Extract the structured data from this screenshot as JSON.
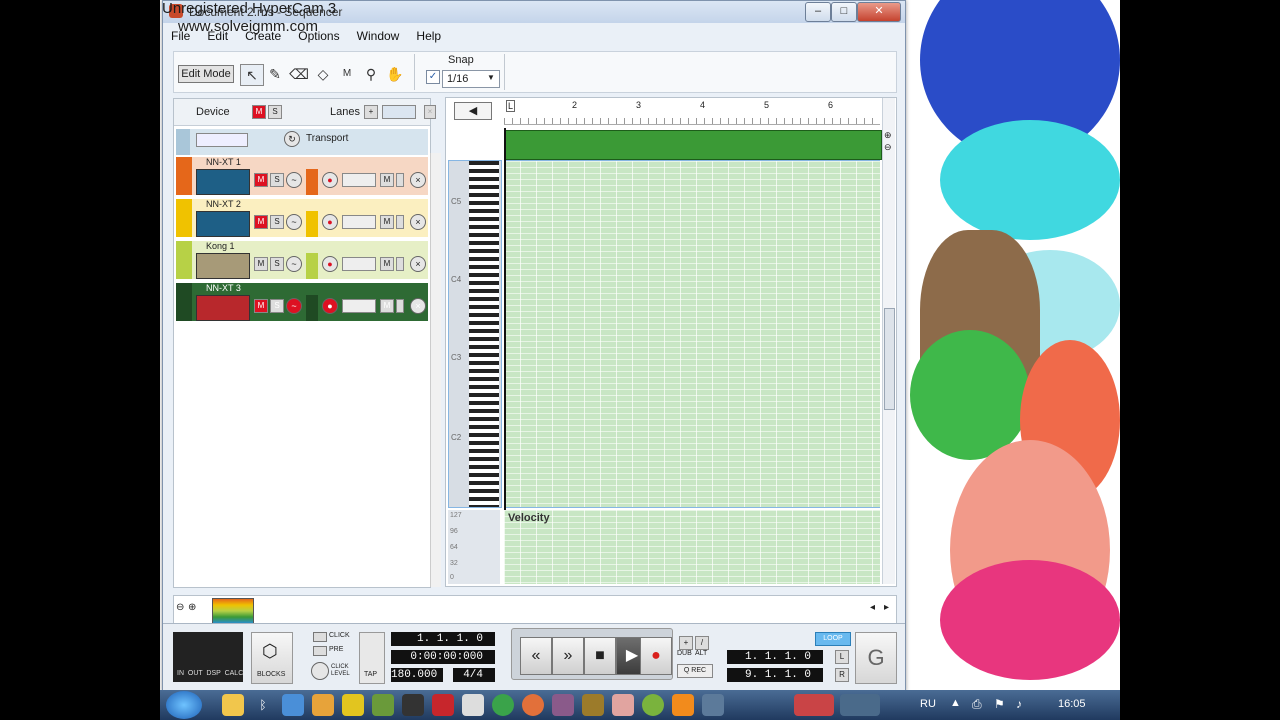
{
  "watermark": {
    "line1": "Unregistered HyperCam 3",
    "line2": "www.solveigmm.com"
  },
  "window": {
    "title": "Document 2.rns - Sequencer",
    "buttons": [
      "–",
      "□",
      "✕"
    ]
  },
  "menu": [
    "File",
    "Edit",
    "Create",
    "Options",
    "Window",
    "Help"
  ],
  "toolbar": {
    "edit_mode_label": "Edit Mode",
    "snap_label": "Snap",
    "snap_value": "1/16",
    "tools": [
      "pointer-icon",
      "pencil-icon",
      "eraser-icon",
      "razor-icon",
      "mute-tool-icon",
      "magnify-icon",
      "hand-icon"
    ]
  },
  "track_header": {
    "device_label": "Device",
    "lanes_label": "Lanes"
  },
  "tracks": [
    {
      "name": "Transport",
      "color": "#a9c6d9"
    },
    {
      "name": "NN-XT 1",
      "color": "#e5671a"
    },
    {
      "name": "NN-XT 2",
      "color": "#f0c200"
    },
    {
      "name": "Kong 1",
      "color": "#b7d146"
    },
    {
      "name": "NN-XT 3",
      "color": "#2e6a34"
    }
  ],
  "ruler": {
    "bars": [
      "2",
      "3",
      "4",
      "5",
      "6"
    ]
  },
  "piano": {
    "octave_labels": [
      "C5",
      "C4",
      "C3",
      "C2"
    ]
  },
  "velocity": {
    "label": "Velocity",
    "scale": [
      "127",
      "96",
      "64",
      "32",
      "0"
    ]
  },
  "transport": {
    "click_label": "CLICK",
    "pre_label": "PRE",
    "click_level_label": "CLICK LEVEL",
    "tap_label": "TAP",
    "blocks_label": "BLOCKS",
    "meters": "IN  OUT  DSP  CALC",
    "position": "1. 1. 1.   0",
    "time": "0:00:00:000",
    "tempo": "180.000",
    "signature": "4/4",
    "dub_label": "DUB",
    "alt_label": "ALT",
    "qrec_label": "Q REC",
    "loop_label": "LOOP",
    "loop_left": "1. 1. 1.   0",
    "loop_right": "9. 1. 1.   0",
    "l_marker": "L",
    "r_marker": "R"
  },
  "taskbar": {
    "lang": "RU",
    "clock": "16:05"
  },
  "colors": {
    "clip_green": "#3b9a36",
    "grid_green": "#c8e6c4",
    "window_bg": "#eaf0f7",
    "record_red": "#d9201c"
  }
}
